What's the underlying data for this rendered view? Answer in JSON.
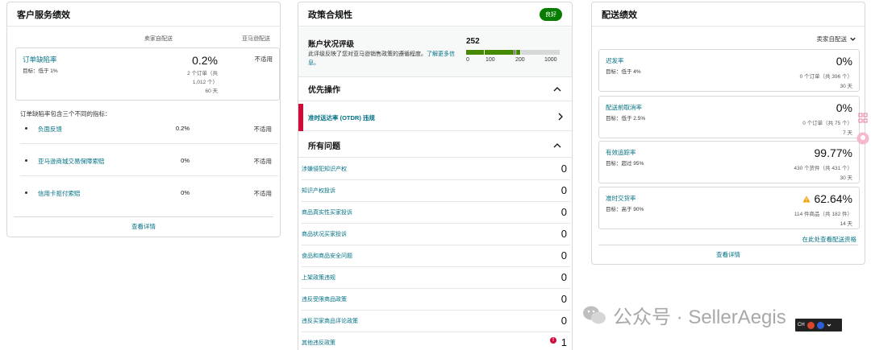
{
  "customer_service": {
    "title": "客户服务绩效",
    "col_seller": "卖家自配送",
    "col_amazon": "亚马逊配送",
    "odr": {
      "label": "订单缺陷率",
      "target": "目标：低于 1%",
      "value": "0.2%",
      "detail_1": "2 个订单（共",
      "detail_2": "1,012 个）",
      "detail_3": "60 天",
      "amazon": "不适用"
    },
    "desc": "订单缺陷率包含三个不同的指标：",
    "metrics": [
      {
        "label": "负面反馈",
        "value": "0.2%",
        "amazon": "不适用"
      },
      {
        "label": "亚马逊商城交易保障索赔",
        "value": "0%",
        "amazon": "不适用"
      },
      {
        "label": "信用卡拒付索赔",
        "value": "0%",
        "amazon": "不适用"
      }
    ],
    "footer": "查看详情"
  },
  "policy": {
    "title": "政策合规性",
    "badge": "良好",
    "health": {
      "title": "账户状况评级",
      "desc": "此评级反映了您对亚马逊销售政策的遵循程度。",
      "learn_more": "了解更多信息。",
      "score": "252",
      "ticks": [
        "0",
        "100",
        "200",
        "1000"
      ],
      "colors": {
        "red": "#cc0c39",
        "green": "#458a00",
        "gray": "#d5d9d9"
      }
    },
    "priority_title": "优先操作",
    "priority_item": "准时送达率 (OTDR) 违规",
    "issues_title": "所有问题",
    "issues": [
      {
        "label": "涉嫌侵犯知识产权",
        "count": "0"
      },
      {
        "label": "知识产权投诉",
        "count": "0"
      },
      {
        "label": "商品真实性买家投诉",
        "count": "0"
      },
      {
        "label": "商品状况买家投诉",
        "count": "0"
      },
      {
        "label": "食品和商品安全问题",
        "count": "0"
      },
      {
        "label": "上架政策违规",
        "count": "0"
      },
      {
        "label": "违反受限商品政策",
        "count": "0"
      },
      {
        "label": "违反买家商品评论政策",
        "count": "0"
      },
      {
        "label": "其他违反政策",
        "count": "1"
      }
    ]
  },
  "shipping": {
    "title": "配送绩效",
    "select": "卖家自配送",
    "metrics": [
      {
        "label": "迟发率",
        "target": "目标：低于 4%",
        "value": "0%",
        "detail": "0 个订单（共 396 个）",
        "days": "30 天"
      },
      {
        "label": "配送前取消率",
        "target": "目标：低于 2.5%",
        "value": "0%",
        "detail": "0 个订单（共 75 个）",
        "days": "7 天"
      },
      {
        "label": "有效追踪率",
        "target": "目标：超过 95%",
        "value": "99.77%",
        "detail": "430 个货件（共 431 个）",
        "days": "30 天"
      },
      {
        "label": "准时交货率",
        "target": "目标：高于 90%",
        "value": "62.64%",
        "detail": "114 件商品（共 182 件）",
        "days": "14 天",
        "warning": true
      }
    ],
    "eligibility": "在此处查看配送资格",
    "footer": "查看详情"
  },
  "watermark": {
    "text": "公众号 · SellerAegis"
  },
  "tray": {
    "lang": "CH"
  }
}
